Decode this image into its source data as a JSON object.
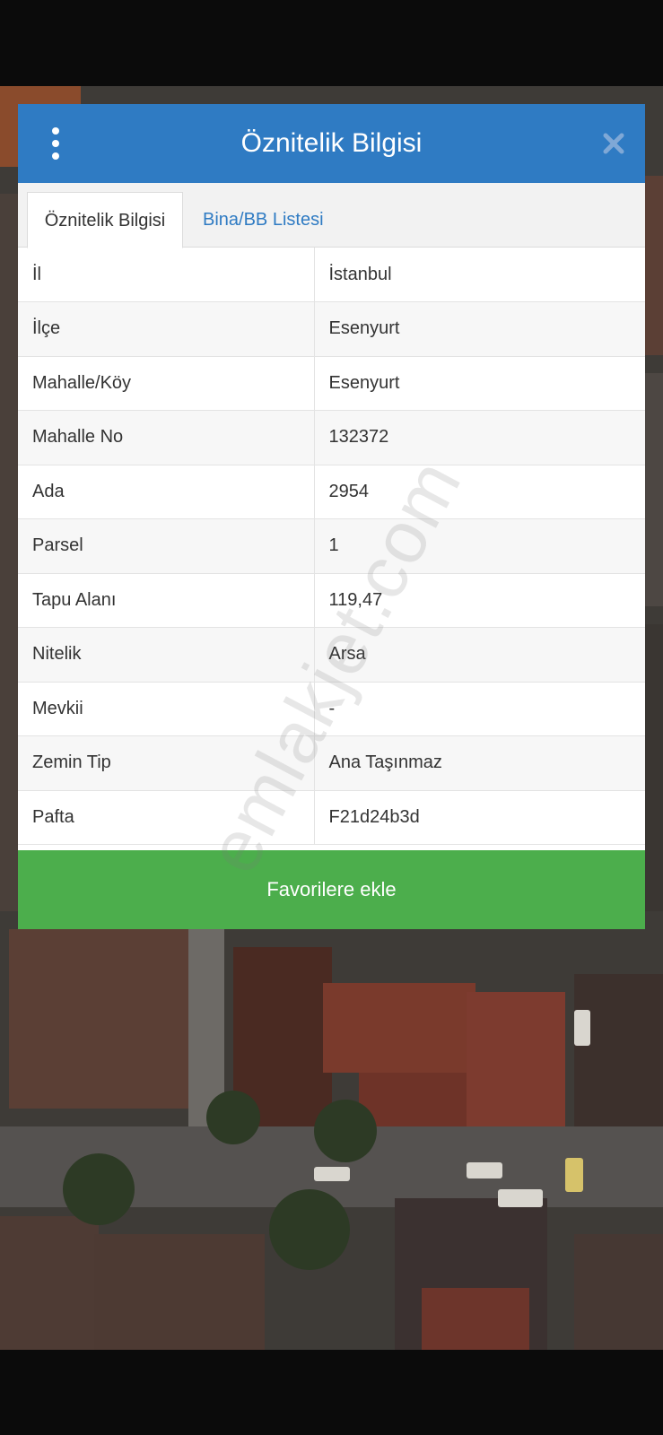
{
  "modal": {
    "title": "Öznitelik Bilgisi",
    "menu_icon": "kebab-menu-icon",
    "close_icon": "close-icon"
  },
  "tabs": [
    {
      "label": "Öznitelik Bilgisi",
      "active": true
    },
    {
      "label": "Bina/BB Listesi",
      "active": false
    }
  ],
  "attributes": [
    {
      "key": "İl",
      "value": "İstanbul"
    },
    {
      "key": "İlçe",
      "value": "Esenyurt"
    },
    {
      "key": "Mahalle/Köy",
      "value": "Esenyurt"
    },
    {
      "key": "Mahalle No",
      "value": "132372"
    },
    {
      "key": "Ada",
      "value": "2954"
    },
    {
      "key": "Parsel",
      "value": "1"
    },
    {
      "key": "Tapu Alanı",
      "value": "119,47"
    },
    {
      "key": "Nitelik",
      "value": "Arsa"
    },
    {
      "key": "Mevkii",
      "value": "-"
    },
    {
      "key": "Zemin Tip",
      "value": "Ana Taşınmaz"
    },
    {
      "key": "Pafta",
      "value": "F21d24b3d"
    }
  ],
  "actions": {
    "favorite_label": "Favorilere ekle"
  },
  "watermark": "emlakjet.com",
  "colors": {
    "header": "#2f7bc3",
    "tab_link": "#2f7bc3",
    "favorite_button": "#4cae4c"
  }
}
